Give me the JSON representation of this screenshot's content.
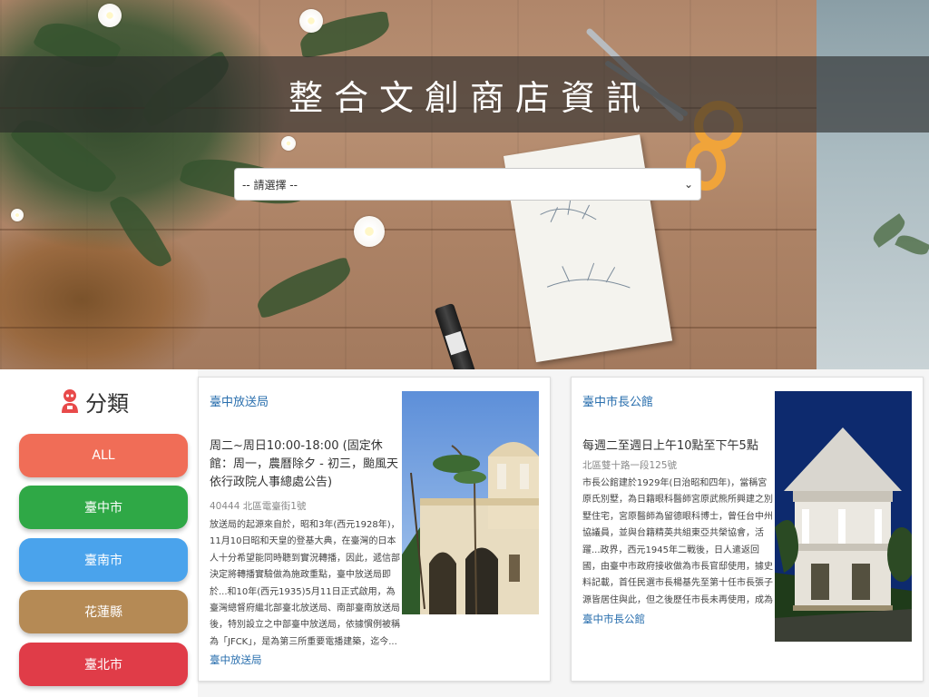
{
  "header": {
    "title": "整合文創商店資訊",
    "select_value": "-- 請選擇 --"
  },
  "sidebar": {
    "title": "分類",
    "icon": "user-icon",
    "categories": [
      {
        "label": "ALL",
        "color": "#f06d57"
      },
      {
        "label": "臺中市",
        "color": "#2fa846"
      },
      {
        "label": "臺南市",
        "color": "#4aa3ec"
      },
      {
        "label": "花蓮縣",
        "color": "#b58a55"
      },
      {
        "label": "臺北市",
        "color": "#e03c48"
      }
    ]
  },
  "stores": [
    {
      "name": "臺中放送局",
      "hours": "周二~周日10:00-18:00 (固定休館：周一，農曆除夕 - 初三，颱風天依行政院人事總處公告)",
      "address": "40444 北區電臺街1號",
      "description": "放送局的起源來自於，昭和3年(西元1928年)，11月10日昭和天皇的登基大典，在臺灣的日本人十分希望能同時聽到實況轉播，因此，遞信部決定將轉播實驗做為施政重點，臺中放送局即於...和10年(西元1935)5月11日正式啟用，為臺灣總督府繼北部臺北放送局、南部臺南放送局後，特別設立之中部臺中放送局，依據慣例被稱為「JFCK」，是為第三所重要電播建築，迄今...",
      "link": "臺中放送局"
    },
    {
      "name": "臺中市長公館",
      "hours": "每週二至週日上午10點至下午5點",
      "address": "北區雙十路一段125號",
      "description": "市長公館建於1929年(日治昭和四年)，當稱宮原氏別墅，為日籍眼科醫師宮原武熊所興建之別墅住宅，宮原醫師為留德眼科博士，曾任台中州協議員，並與台籍精英共組東亞共榮協會，活躍...政界，西元1945年二戰後，日人遣返回國，由臺中市政府接收做為市長官邸使用，據史料記載，首任民選市長楊基先至第十任市長張子源皆居住與此，但之後歷任市長未再使用，成為閒置空...",
      "link": "臺中市長公館"
    }
  ]
}
